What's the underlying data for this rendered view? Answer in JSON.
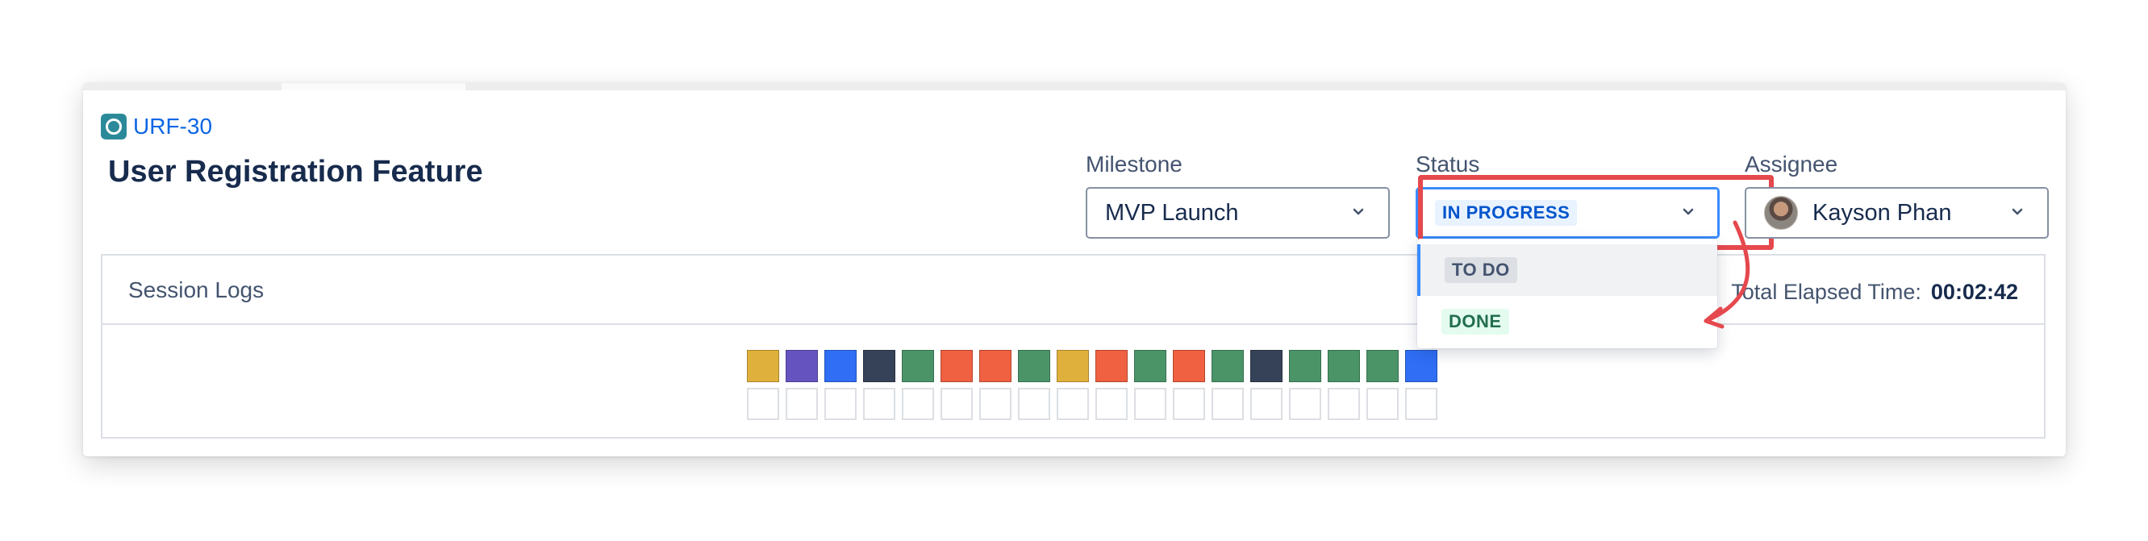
{
  "issue": {
    "key": "URF-30",
    "title": "User Registration Feature",
    "type_icon": "circle-icon"
  },
  "fields": {
    "milestone": {
      "label": "Milestone",
      "value": "MVP Launch"
    },
    "status": {
      "label": "Status",
      "value": "IN PROGRESS"
    },
    "assignee": {
      "label": "Assignee",
      "value": "Kayson Phan"
    }
  },
  "status_dropdown": {
    "options": [
      "TO DO",
      "DONE"
    ]
  },
  "session_logs": {
    "title": "Session Logs",
    "elapsed_label": "Total Elapsed Time:",
    "elapsed_value": "00:02:42",
    "blocks": [
      "#dfb13c",
      "#6554c0",
      "#2f6ef5",
      "#364257",
      "#4a9468",
      "#ef6141",
      "#ef6141",
      "#4a9468",
      "#dfb13c",
      "#ef6141",
      "#4a9468",
      "#ef6141",
      "#4a9468",
      "#364257",
      "#4a9468",
      "#4a9468",
      "#4a9468",
      "#2f6ef5"
    ]
  },
  "colors": {
    "accent": "#388bff",
    "highlight": "#e5484d",
    "link": "#0c66e4"
  }
}
